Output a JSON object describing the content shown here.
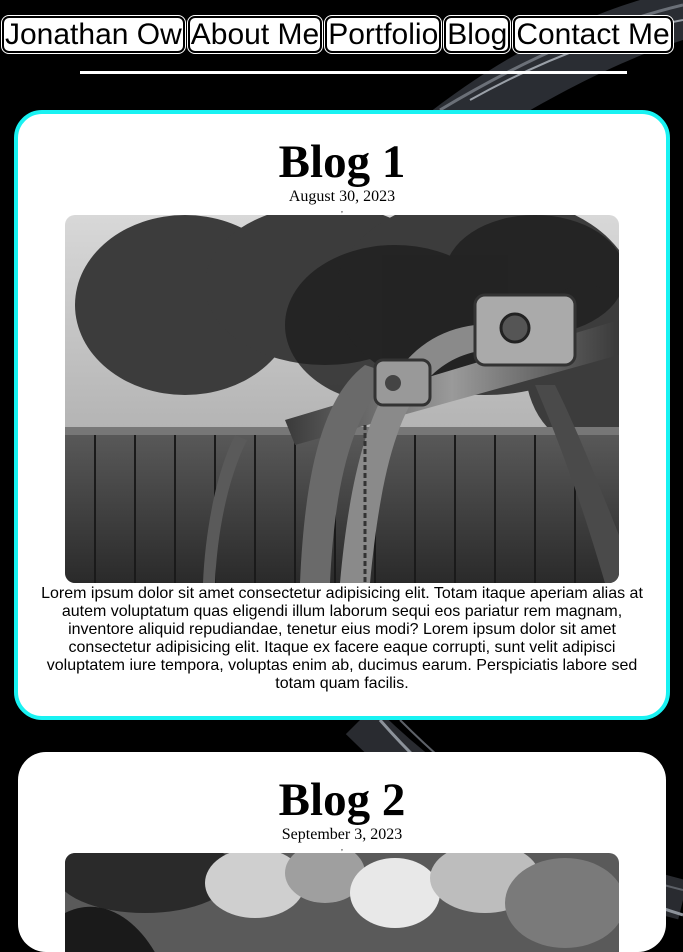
{
  "nav": {
    "items": [
      "Jonathan Ow",
      "About Me",
      "Portfolio",
      "Blog",
      "Contact Me"
    ]
  },
  "posts": [
    {
      "title": "Blog 1",
      "date": "August 30, 2023",
      "separator": ",",
      "image": "black-and-white swing set photo",
      "body": "Lorem ipsum dolor sit amet consectetur adipisicing elit. Totam itaque aperiam alias at autem voluptatum quas eligendi illum laborum sequi eos pariatur rem magnam, inventore aliquid repudiandae, tenetur eius modi? Lorem ipsum dolor sit amet consectetur adipisicing elit. Itaque ex facere eaque corrupti, sunt velit adipisci voluptatem iure tempora, voluptas enim ab, ducimus earum. Perspiciatis labore sed totam quam facilis."
    },
    {
      "title": "Blog 2",
      "date": "September 3, 2023",
      "separator": ",",
      "image": "black-and-white blurred photo"
    }
  ],
  "colors": {
    "background": "#000000",
    "card": "#ffffff",
    "active_border": "#19f2f2"
  }
}
